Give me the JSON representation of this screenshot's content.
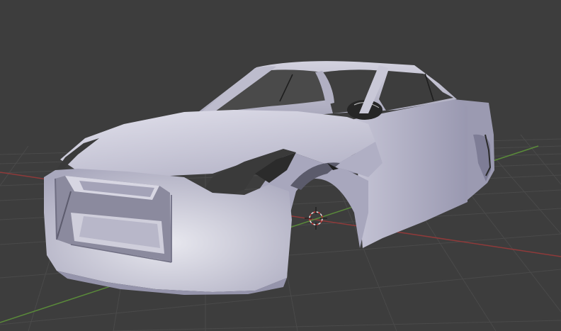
{
  "viewport": {
    "background_color": "#3d3d3d",
    "grid_color": "#4a4a4a",
    "x_axis_color": "#8f3a3a",
    "y_axis_color": "#5a8a3a",
    "model_color": "#c9c8d6",
    "cursor_icon": "3d-cursor-icon"
  }
}
